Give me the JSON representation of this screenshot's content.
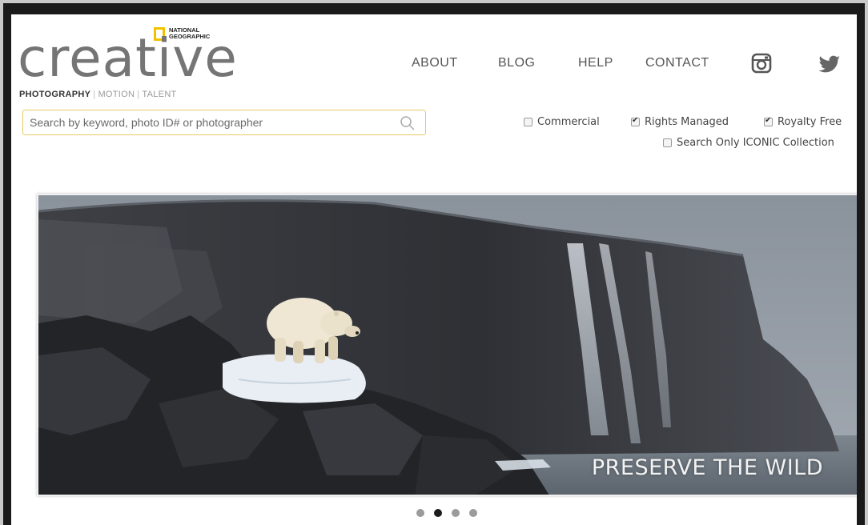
{
  "brand": {
    "partner": "NATIONAL\nGEOGRAPHIC",
    "wordmark": "creative",
    "tagline": {
      "primary": "PHOTOGRAPHY",
      "secondary": [
        "MOTION",
        "TALENT"
      ]
    },
    "accent_color": "#f2c200"
  },
  "nav": {
    "links": [
      "ABOUT",
      "BLOG",
      "HELP",
      "CONTACT"
    ],
    "social": [
      "instagram-icon",
      "twitter-icon"
    ]
  },
  "search": {
    "placeholder": "Search by keyword, photo ID# or photographer",
    "value": ""
  },
  "filters": {
    "commercial": {
      "label": "Commercial",
      "checked": false
    },
    "rights_managed": {
      "label": "Rights Managed",
      "checked": true
    },
    "royalty_free": {
      "label": "Royalty Free",
      "checked": true
    },
    "iconic": {
      "label": "Search Only ICONIC Collection",
      "checked": false
    }
  },
  "hero": {
    "caption": "PRESERVE THE WILD"
  },
  "carousel": {
    "slides": 4,
    "active_index": 1
  }
}
